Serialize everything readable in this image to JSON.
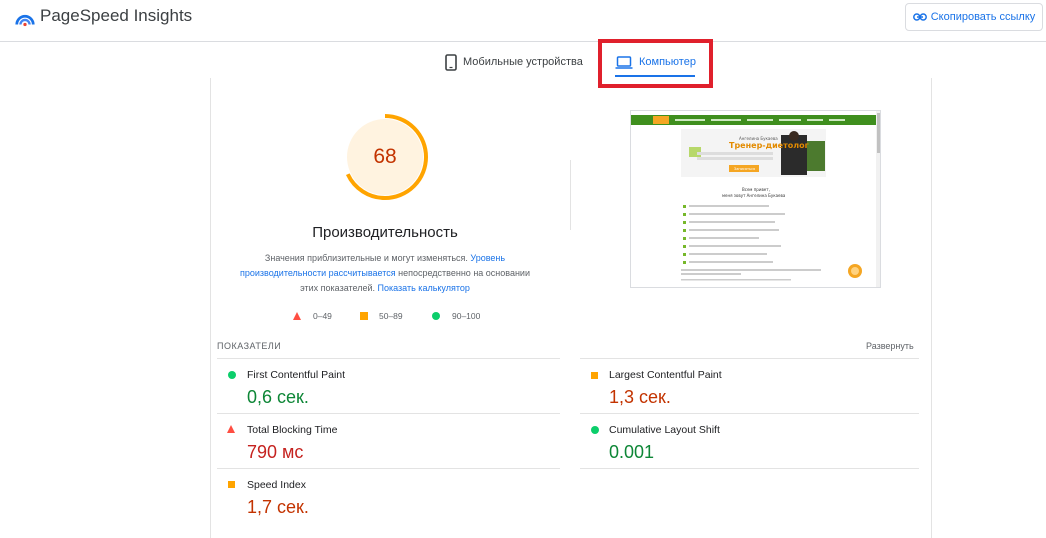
{
  "header": {
    "app_title": "PageSpeed Insights",
    "copy_link_label": "Скопировать ссылку"
  },
  "tabs": [
    {
      "label": "Мобильные устройства",
      "selected": false
    },
    {
      "label": "Компьютер",
      "selected": true
    }
  ],
  "summary": {
    "score": "68",
    "title": "Производительность",
    "desc_part1": "Значения приблизительные и могут изменяться.",
    "desc_link1": "Уровень производительности рассчитывается",
    "desc_part2": "непосредственно на основании этих показателей.",
    "desc_link2": "Показать калькулятор",
    "legend": [
      {
        "range": "0–49",
        "color": "#ff4e42"
      },
      {
        "range": "50–89",
        "color": "#ffa400"
      },
      {
        "range": "90–100",
        "color": "#0cce6b"
      }
    ]
  },
  "screenshot": {
    "hero_line1": "Ангелина Букаева",
    "hero_title": "Тренер-диетолог",
    "hero_button": "Записаться",
    "section_line1": "Всем привет,",
    "section_line2": "меня зовут Ангелина Букаева"
  },
  "metrics_section": {
    "label": "ПОКАЗАТЕЛИ",
    "expand_label": "Развернуть",
    "items": [
      {
        "name": "First Contentful Paint",
        "value": "0,6 сек.",
        "status": "good"
      },
      {
        "name": "Largest Contentful Paint",
        "value": "1,3 сек.",
        "status": "average"
      },
      {
        "name": "Total Blocking Time",
        "value": "790 мс",
        "status": "poor"
      },
      {
        "name": "Cumulative Layout Shift",
        "value": "0.001",
        "status": "good"
      },
      {
        "name": "Speed Index",
        "value": "1,7 сек.",
        "status": "average"
      }
    ]
  },
  "colors": {
    "accent": "#1a73e8",
    "good": "#0cce6b",
    "average": "#ffa400",
    "poor": "#ff4e42",
    "highlight": "#e0202c"
  }
}
